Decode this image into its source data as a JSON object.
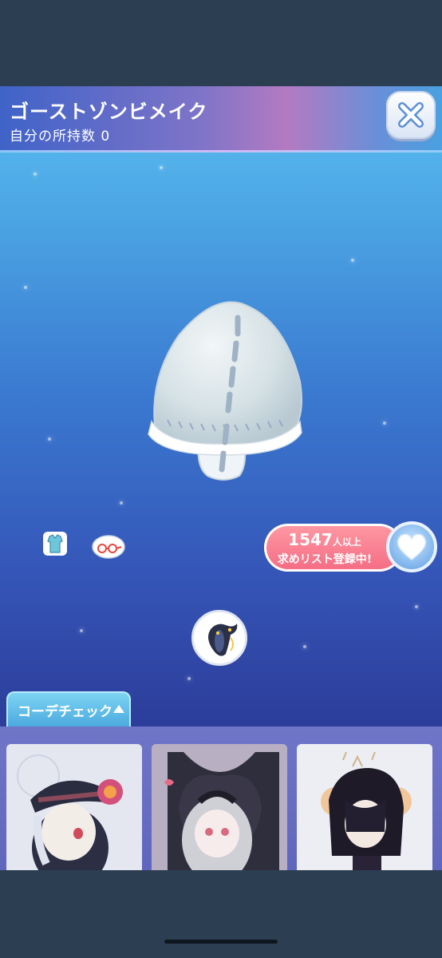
{
  "item": {
    "name": "ゴーストゾンビメイク",
    "owned_label": "自分の所持数",
    "owned_count": "0"
  },
  "wishlist": {
    "count": "1547",
    "count_suffix": "人以上",
    "label": "求めリスト登録中!"
  },
  "coordinate": {
    "tab_label": "コーデチェック"
  },
  "icons": {
    "close": "close-icon",
    "heart": "heart-icon",
    "outfit": "outfit-category-icon",
    "accessory": "glasses-category-icon",
    "character": "character-face-icon"
  },
  "colors": {
    "header_start": "#3f63c8",
    "header_mid": "#b47ac2",
    "wish_pill": "#f46b83",
    "tab": "#4aa8de",
    "panel": "#6f76c8"
  }
}
